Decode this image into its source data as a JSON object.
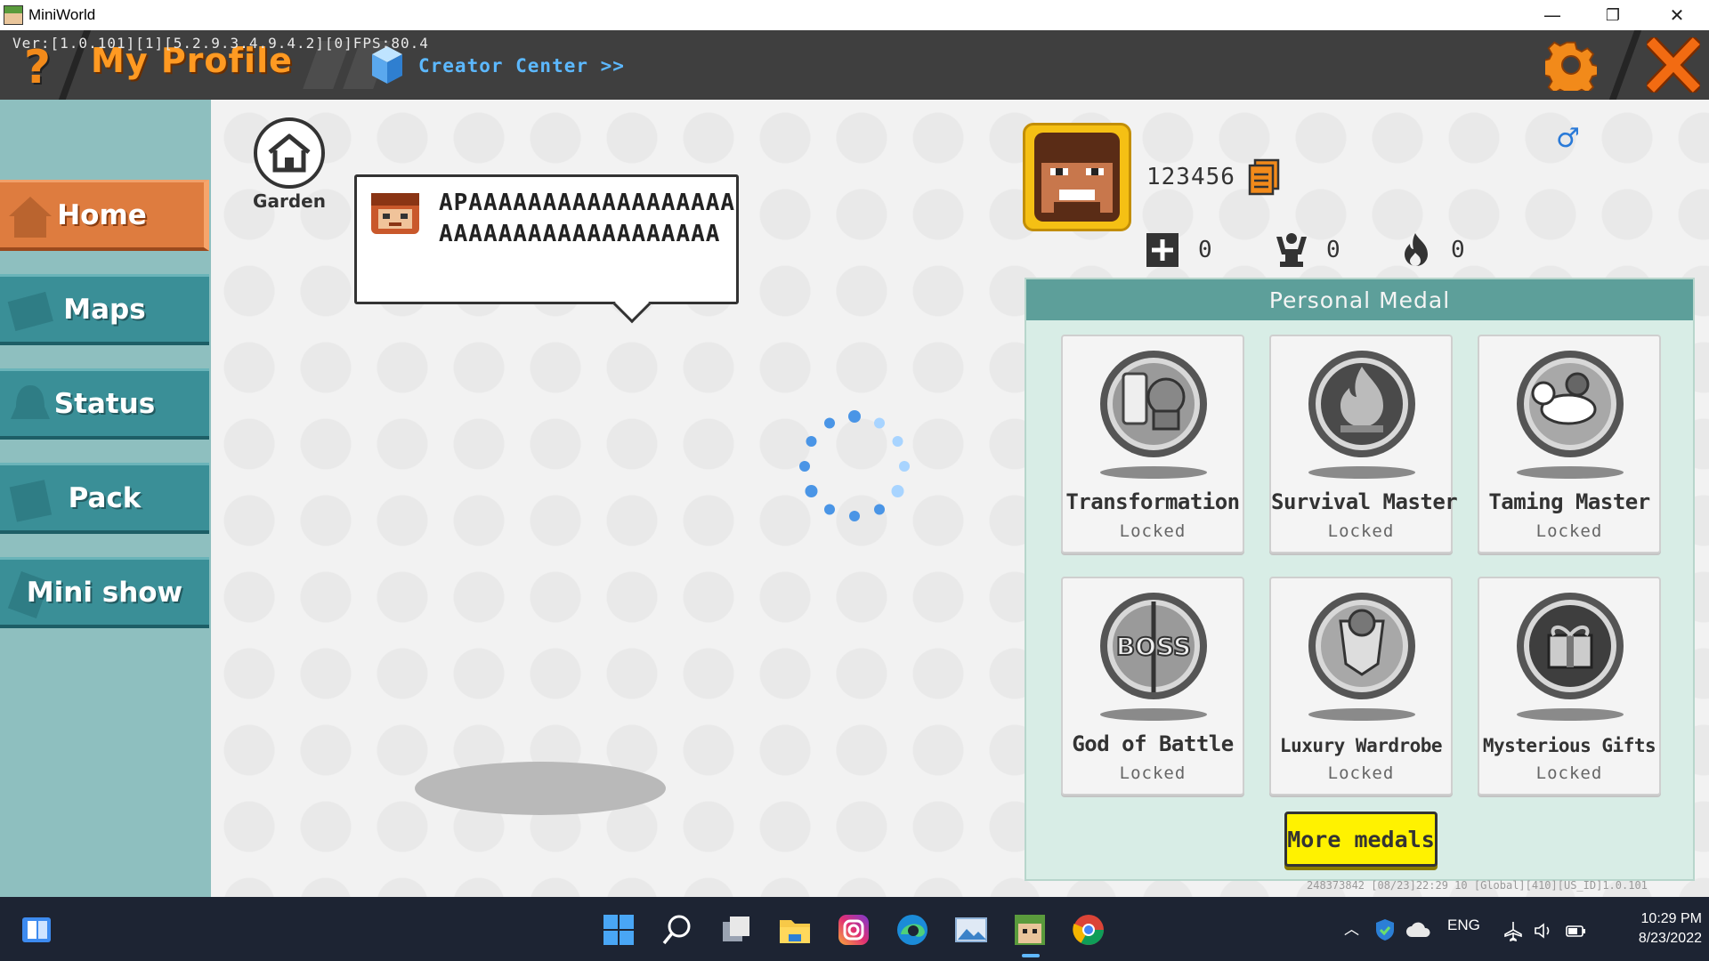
{
  "window": {
    "title": "MiniWorld",
    "minimize": "—",
    "restore": "❐",
    "close": "✕"
  },
  "header": {
    "version": "Ver:[1.0.101][1][5.2.9.3.4.9.4.2][0]FPS:80.4",
    "help": "?",
    "title": "My Profile",
    "creator_center": "Creator Center >>",
    "settings_icon": "gear-icon",
    "close_icon": "close-icon",
    "accent": "#f28a1a"
  },
  "sidebar": {
    "items": [
      {
        "label": "Home",
        "active": true,
        "icon": "house-icon"
      },
      {
        "label": "Maps",
        "active": false,
        "icon": "map-icon"
      },
      {
        "label": "Status",
        "active": false,
        "icon": "bell-icon"
      },
      {
        "label": "Pack",
        "active": false,
        "icon": "box-icon"
      },
      {
        "label": "Mini show",
        "active": false,
        "icon": "star-icon"
      }
    ],
    "active_color": "#de7c3f",
    "item_color": "#3a8f97"
  },
  "main": {
    "garden_label": "Garden",
    "signature": "APAAAAAAAAAAAAAAAAAAAAAAAAAAAAAAAAAAAAA",
    "spinner": "loading-spinner"
  },
  "profile": {
    "uid": "123456",
    "gender_symbol": "♂",
    "stats": [
      {
        "icon": "plus-icon",
        "value": "0"
      },
      {
        "icon": "trophy-icon",
        "value": "0"
      },
      {
        "icon": "fire-icon",
        "value": "0"
      }
    ]
  },
  "medals": {
    "header": "Personal Medal",
    "items": [
      {
        "name": "Transformation",
        "status": "Locked",
        "icon": "transformation-medal-icon"
      },
      {
        "name": "Survival Master",
        "status": "Locked",
        "icon": "campfire-medal-icon"
      },
      {
        "name": "Taming Master",
        "status": "Locked",
        "icon": "horse-medal-icon"
      },
      {
        "name": "God of Battle",
        "status": "Locked",
        "icon": "boss-medal-icon"
      },
      {
        "name": "Luxury Wardrobe",
        "status": "Locked",
        "icon": "armor-medal-icon"
      },
      {
        "name": "Mysterious Gifts",
        "status": "Locked",
        "icon": "gift-medal-icon"
      }
    ],
    "more_button": "More medals",
    "footer": "248373842   [08/23]22:29 10  [Global][410][US_ID]1.0.101"
  },
  "taskbar": {
    "apps": [
      "start-icon",
      "search-icon",
      "task-view-icon",
      "file-explorer-icon",
      "instagram-icon",
      "edge-icon",
      "photos-icon",
      "miniworld-icon",
      "chrome-icon"
    ],
    "language": "ENG",
    "time": "10:29 PM",
    "date": "8/23/2022"
  }
}
